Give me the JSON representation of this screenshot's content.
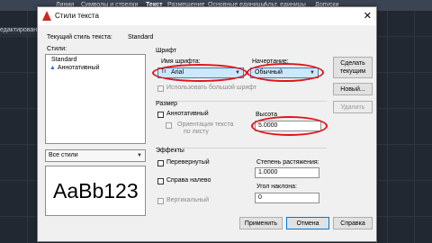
{
  "ribbon": {
    "tabs": [
      "Линии",
      "Символы и стрелки",
      "Текст",
      "Размещение",
      "Основные единицы",
      "Альт. единицы",
      "Допуски"
    ],
    "left_label": "едактирован..."
  },
  "dialog": {
    "title": "Стили текста",
    "current_style_label": "Текущий стиль текста:",
    "current_style_value": "Standard",
    "styles_label": "Стили:",
    "styles": [
      "Standard",
      "Аннотативный"
    ],
    "filter_value": "Все стили",
    "preview_text": "AaBb123",
    "font": {
      "group_label": "Шрифт",
      "name_label": "Имя шрифта:",
      "name_value": "Arial",
      "name_prefix": "Tr",
      "style_label": "Начертание:",
      "style_value": "Обычный",
      "bigfont_label": "Использовать большой шрифт"
    },
    "size": {
      "group_label": "Размер",
      "annotative_label": "Аннотативный",
      "orientation_label_1": "Ориентация текста",
      "orientation_label_2": "по листу",
      "height_label": "Высота",
      "height_value": "5.0000"
    },
    "effects": {
      "group_label": "Эффекты",
      "upside_down": "Перевернутый",
      "backwards": "Справа налево",
      "vertical": "Вертикальный",
      "width_label": "Степень растяжения:",
      "width_value": "1.0000",
      "oblique_label": "Угол наклона:",
      "oblique_value": "0"
    },
    "buttons": {
      "set_current_1": "Сделать",
      "set_current_2": "текущим",
      "new": "Новый...",
      "delete": "Удалить",
      "apply": "Применить",
      "cancel": "Отмена",
      "help": "Справка"
    }
  },
  "colors": {
    "highlight": "#e0141c",
    "selection": "#cce8ff",
    "logo": "#d0281f"
  }
}
